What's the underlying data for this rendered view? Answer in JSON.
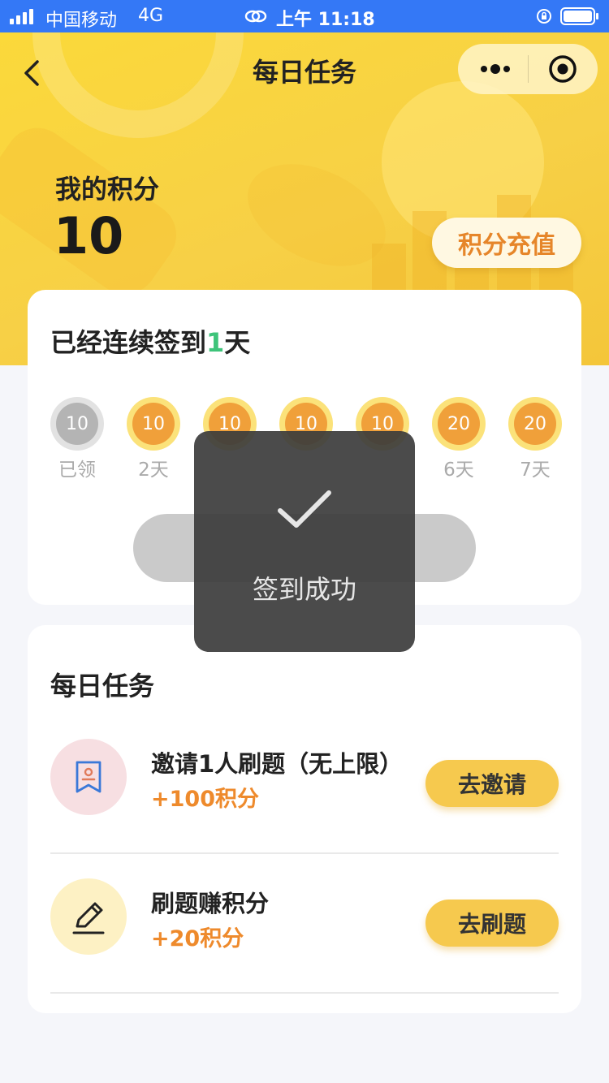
{
  "status_bar": {
    "carrier": "中国移动",
    "network": "4G",
    "time": "上午 11:18"
  },
  "nav": {
    "title": "每日任务"
  },
  "points": {
    "label": "我的积分",
    "value": "10",
    "recharge_label": "积分充值"
  },
  "signin": {
    "title_prefix": "已经连续签到",
    "streak": "1",
    "title_suffix": "天",
    "days": [
      {
        "value": "10",
        "label": "已领",
        "claimed": true
      },
      {
        "value": "10",
        "label": "2天",
        "claimed": false
      },
      {
        "value": "10",
        "label": "",
        "claimed": false
      },
      {
        "value": "10",
        "label": "",
        "claimed": false
      },
      {
        "value": "10",
        "label": "",
        "claimed": false
      },
      {
        "value": "20",
        "label": "6天",
        "claimed": false
      },
      {
        "value": "20",
        "label": "7天",
        "claimed": false
      }
    ]
  },
  "toast": {
    "icon": "checkmark-icon",
    "text": "签到成功"
  },
  "tasks": {
    "title": "每日任务",
    "items": [
      {
        "name": "邀请1人刷题（无上限）",
        "reward": "+100积分",
        "button": "去邀请",
        "icon": "invite-card-icon"
      },
      {
        "name": "刷题赚积分",
        "reward": "+20积分",
        "button": "去刷题",
        "icon": "pencil-icon"
      }
    ]
  },
  "colors": {
    "status_bar": "#3478f6",
    "header_yellow": "#f7d046",
    "accent_orange": "#ee8a2c",
    "streak_green": "#3ec47a",
    "button_yellow": "#f6c94e"
  }
}
